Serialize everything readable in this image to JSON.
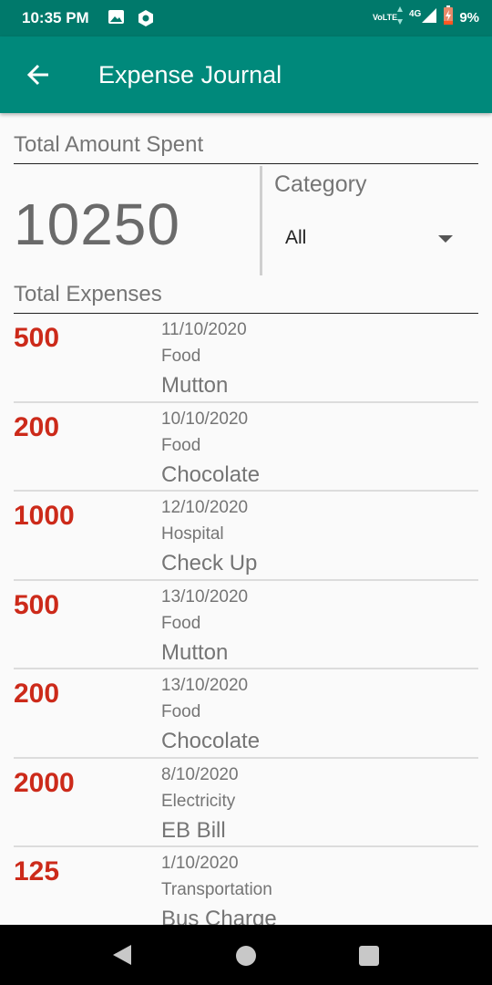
{
  "status_bar": {
    "time": "10:35 PM",
    "volte": "VoLTE",
    "network": "4G",
    "battery": "9%"
  },
  "app_bar": {
    "title": "Expense Journal"
  },
  "summary": {
    "total_label": "Total Amount Spent",
    "total_amount": "10250",
    "category_label": "Category",
    "category_value": "All",
    "expenses_label": "Total Expenses"
  },
  "expenses": [
    {
      "amount": "500",
      "date": "11/10/2020",
      "category": "Food",
      "description": "Mutton"
    },
    {
      "amount": "200",
      "date": "10/10/2020",
      "category": "Food",
      "description": "Chocolate"
    },
    {
      "amount": "1000",
      "date": "12/10/2020",
      "category": "Hospital",
      "description": "Check Up"
    },
    {
      "amount": "500",
      "date": "13/10/2020",
      "category": "Food",
      "description": "Mutton"
    },
    {
      "amount": "200",
      "date": "13/10/2020",
      "category": "Food",
      "description": "Chocolate"
    },
    {
      "amount": "2000",
      "date": "8/10/2020",
      "category": "Electricity",
      "description": "EB Bill"
    },
    {
      "amount": "125",
      "date": "1/10/2020",
      "category": "Transportation",
      "description": "Bus Charge"
    }
  ],
  "colors": {
    "status_bar": "#00796b",
    "app_bar": "#00897b",
    "amount": "#cc2a1a"
  }
}
